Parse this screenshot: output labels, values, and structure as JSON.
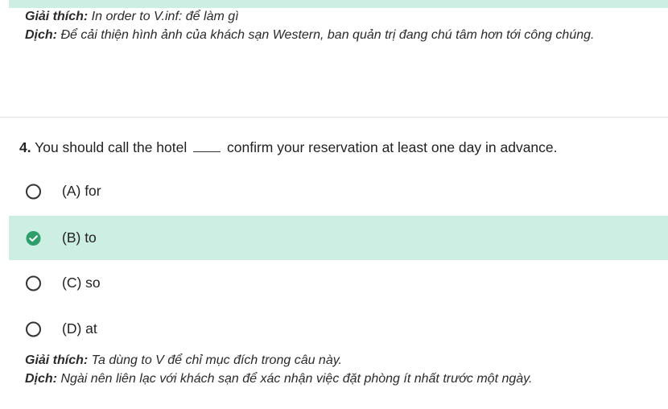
{
  "prev_explanation": {
    "giai_thich_key": "Giải thích:",
    "giai_thich_text": " In order to V.inf: để làm gì",
    "dich_key": "Dịch:",
    "dich_text": " Để cải thiện hình ảnh của khách sạn Western, ban quản trị đang chú tâm hơn tới công chúng."
  },
  "question": {
    "number": "4.",
    "text_before": "You should call the hotel",
    "text_after": "confirm your reservation at least one day in advance."
  },
  "options": [
    {
      "label": "(A) for",
      "state": "unselected"
    },
    {
      "label": "(B) to",
      "state": "correct"
    },
    {
      "label": "(C) so",
      "state": "unselected"
    },
    {
      "label": "(D) at",
      "state": "unselected"
    }
  ],
  "explanation": {
    "giai_thich_key": "Giải thích:",
    "giai_thich_text": " Ta dùng to V để chỉ mục đích trong câu này.",
    "dich_key": "Dịch:",
    "dich_text": " Ngài nên liên lạc với khách sạn để xác nhận việc đặt phòng ít nhất trước một ngày."
  },
  "colors": {
    "highlight": "#cdeee3",
    "check_green": "#2e9e6b"
  },
  "icons": {
    "correct": "check-circle-icon",
    "unselected": "radio-empty-icon"
  }
}
